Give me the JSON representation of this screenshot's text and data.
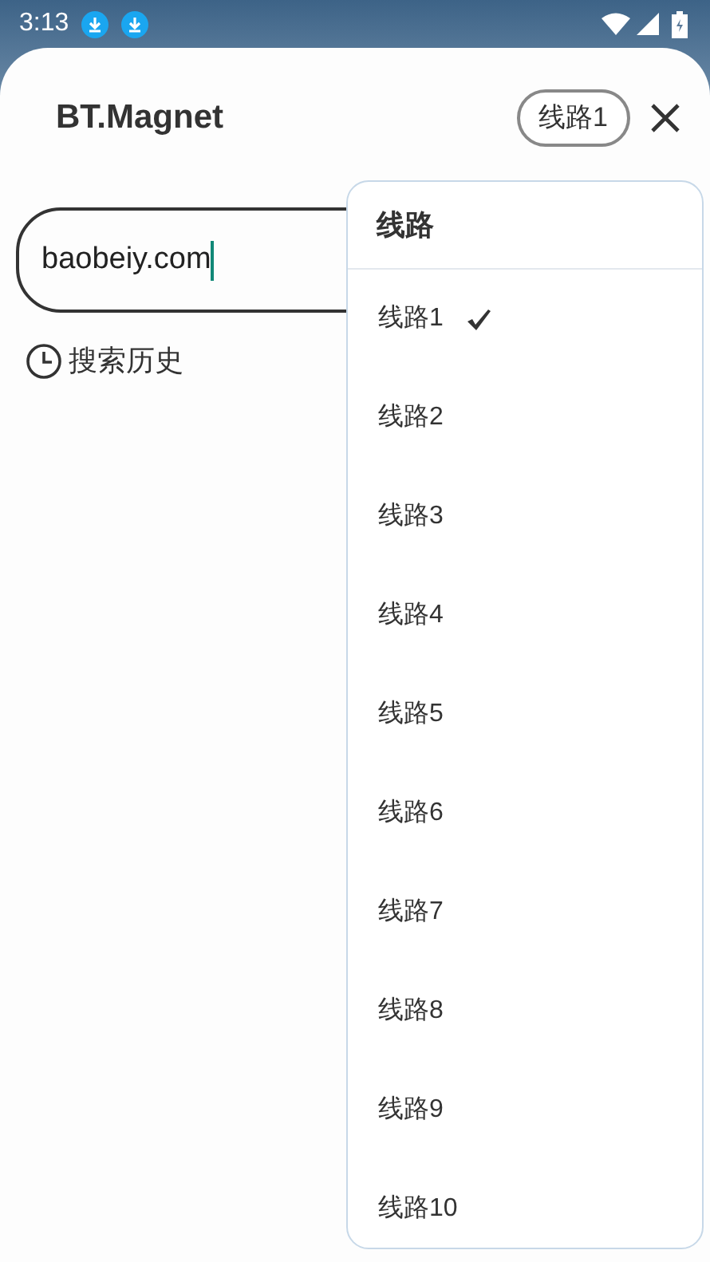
{
  "status_bar": {
    "time": "3:13"
  },
  "header": {
    "title": "BT.Magnet",
    "route_button": "线路1"
  },
  "search": {
    "value": "baobeiy.com"
  },
  "history_link": "搜索历史",
  "route_menu": {
    "title": "线路",
    "items": [
      {
        "label": "线路1",
        "selected": true
      },
      {
        "label": "线路2",
        "selected": false
      },
      {
        "label": "线路3",
        "selected": false
      },
      {
        "label": "线路4",
        "selected": false
      },
      {
        "label": "线路5",
        "selected": false
      },
      {
        "label": "线路6",
        "selected": false
      },
      {
        "label": "线路7",
        "selected": false
      },
      {
        "label": "线路8",
        "selected": false
      },
      {
        "label": "线路9",
        "selected": false
      },
      {
        "label": "线路10",
        "selected": false
      }
    ]
  }
}
